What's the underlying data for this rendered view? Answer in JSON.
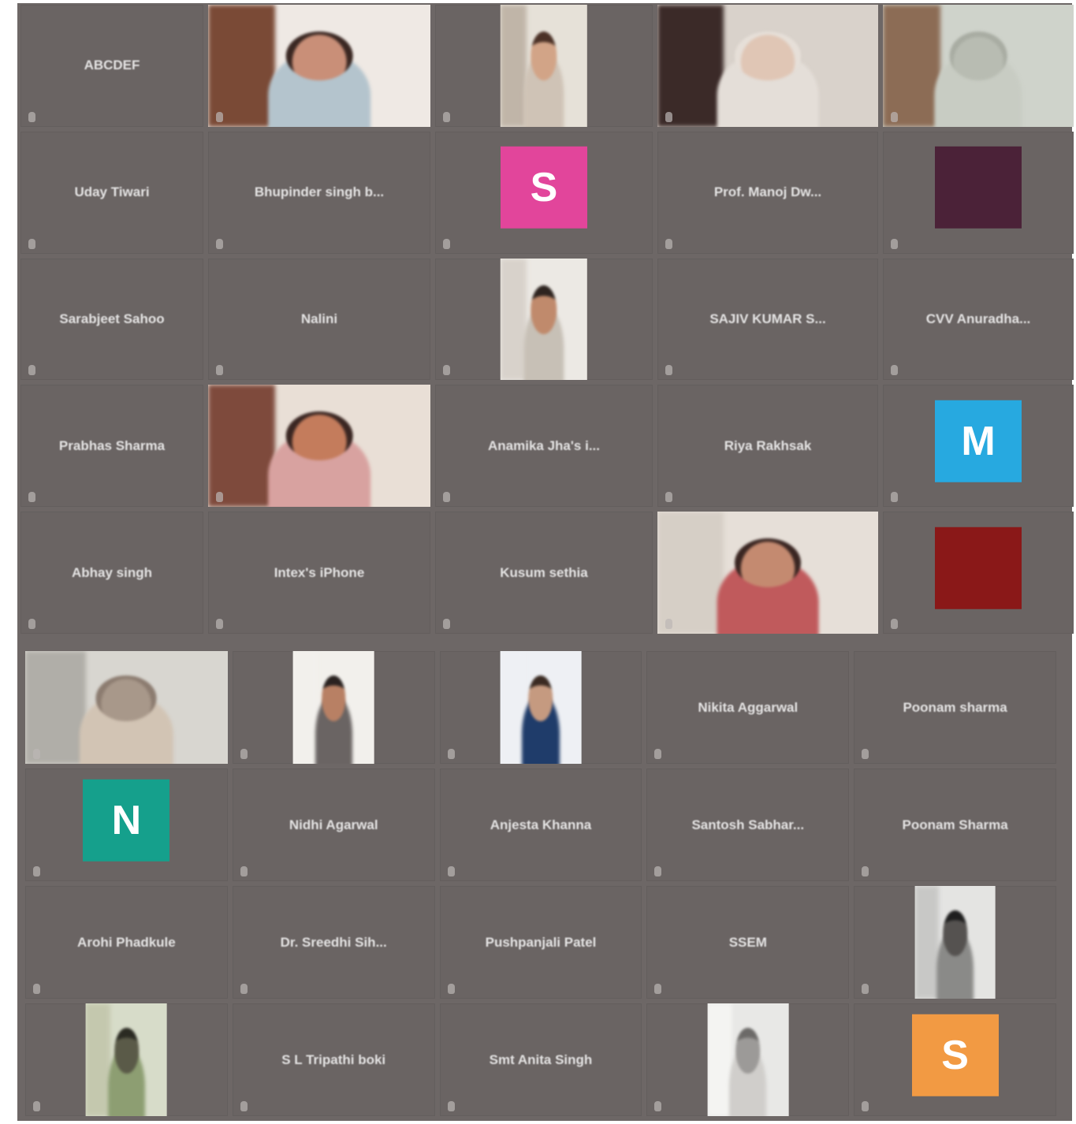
{
  "meeting": {
    "top_gallery": [
      {
        "type": "name",
        "name": "ABCDEF"
      },
      {
        "type": "video",
        "label": "",
        "bg": "#efe9e4",
        "skin": "#c98f78",
        "hair": "#3a2722",
        "cloth": "#b4c4cd",
        "side": "#7a4a36"
      },
      {
        "type": "video",
        "label": "",
        "bg": "#e6e1d8",
        "skin": "#d2a487",
        "hair": "#4b3126",
        "cloth": "#cfc3b6",
        "side": "#c0b5a8",
        "narrow": true
      },
      {
        "type": "video",
        "label": "",
        "bg": "#d9d2cb",
        "skin": "#e0c6b5",
        "hair": "#e6dfd8",
        "cloth": "#e4ded8",
        "side": "#3b2a28"
      },
      {
        "type": "video",
        "label": "",
        "bg": "#cfd3cb",
        "skin": "#b8bcb2",
        "hair": "#a8aca2",
        "cloth": "#c8ccc3",
        "side": "#8c6c55"
      },
      {
        "type": "name",
        "name": "Uday Tiwari"
      },
      {
        "type": "name",
        "name": "Bhupinder singh b..."
      },
      {
        "type": "avatar",
        "letter": "S",
        "color": "#e2459b",
        "label": ""
      },
      {
        "type": "name",
        "name": "Prof. Manoj Dw..."
      },
      {
        "type": "avatar",
        "letter": "",
        "color": "#4b2238",
        "label": ""
      },
      {
        "type": "name",
        "name": "Sarabjeet Sahoo"
      },
      {
        "type": "name",
        "name": "Nalini"
      },
      {
        "type": "video",
        "label": "",
        "bg": "#ece9e4",
        "skin": "#c08a6c",
        "hair": "#2e2420",
        "cloth": "#c7c0b6",
        "side": "#d8d2cb",
        "narrow": true
      },
      {
        "type": "name",
        "name": "SAJIV KUMAR S..."
      },
      {
        "type": "name",
        "name": "CVV Anuradha..."
      },
      {
        "type": "name",
        "name": "Prabhas Sharma"
      },
      {
        "type": "video",
        "label": "",
        "bg": "#e9dfd6",
        "skin": "#c47c5c",
        "hair": "#3a2622",
        "cloth": "#d8a2a0",
        "side": "#7e4a3c",
        "active": true
      },
      {
        "type": "name",
        "name": "Anamika Jha's i..."
      },
      {
        "type": "name",
        "name": "Riya Rakhsak"
      },
      {
        "type": "avatar",
        "letter": "M",
        "color": "#27a9e0",
        "label": ""
      },
      {
        "type": "name",
        "name": "Abhay singh"
      },
      {
        "type": "name",
        "name": "Intex's iPhone"
      },
      {
        "type": "name",
        "name": "Kusum sethia"
      },
      {
        "type": "video",
        "label": "",
        "bg": "#e6dfd8",
        "skin": "#c48a70",
        "hair": "#3a2622",
        "cloth": "#c05a5c",
        "side": "#d6cfc6"
      },
      {
        "type": "avatar",
        "letter": "",
        "color": "#8a1818",
        "label": ""
      }
    ],
    "bottom_gallery": [
      {
        "type": "video",
        "label": "",
        "bg": "#d8d6d0",
        "skin": "#a8988a",
        "hair": "#8c7c70",
        "cloth": "#d2c4b4",
        "side": "#b0aea8"
      },
      {
        "type": "video",
        "label": "",
        "bg": "#f2f0ec",
        "skin": "#b88064",
        "hair": "#2a2220",
        "cloth": "#6a6463",
        "side": "#f2f0ec",
        "narrow": true
      },
      {
        "type": "video",
        "label": "",
        "bg": "#eef0f4",
        "skin": "#c59a80",
        "hair": "#3a2a22",
        "cloth": "#1f3c6a",
        "side": "#eef0f4",
        "narrow": true
      },
      {
        "type": "name",
        "name": "Nikita Aggarwal"
      },
      {
        "type": "name",
        "name": "Poonam sharma"
      },
      {
        "type": "avatar",
        "letter": "N",
        "color": "#15a08c",
        "label": ""
      },
      {
        "type": "name",
        "name": "Nidhi Agarwal"
      },
      {
        "type": "name",
        "name": "Anjesta Khanna"
      },
      {
        "type": "name",
        "name": "Santosh Sabhar..."
      },
      {
        "type": "name",
        "name": "Poonam Sharma"
      },
      {
        "type": "name",
        "name": "Arohi Phadkule"
      },
      {
        "type": "name",
        "name": "Dr. Sreedhi Sih..."
      },
      {
        "type": "name",
        "name": "Pushpanjali Patel"
      },
      {
        "type": "name",
        "name": "SSEM"
      },
      {
        "type": "video",
        "label": "",
        "bg": "#e4e4e2",
        "skin": "#555250",
        "hair": "#1e1e1e",
        "cloth": "#8a8a88",
        "side": "#c8c8c6",
        "narrow": true
      },
      {
        "type": "video",
        "label": "",
        "bg": "#d7dcc9",
        "skin": "#5a5a48",
        "hair": "#2a2a22",
        "cloth": "#8d9e72",
        "side": "#c4c8ae",
        "narrow": true
      },
      {
        "type": "name",
        "name": "S L Tripathi boki"
      },
      {
        "type": "name",
        "name": "Smt Anita Singh"
      },
      {
        "type": "video",
        "label": "",
        "bg": "#e8e8e6",
        "skin": "#9c9a98",
        "hair": "#6c6a68",
        "cloth": "#d0cecb",
        "side": "#f4f4f2",
        "narrow": true
      },
      {
        "type": "avatar",
        "letter": "S",
        "color": "#f29a43",
        "label": ""
      }
    ]
  }
}
